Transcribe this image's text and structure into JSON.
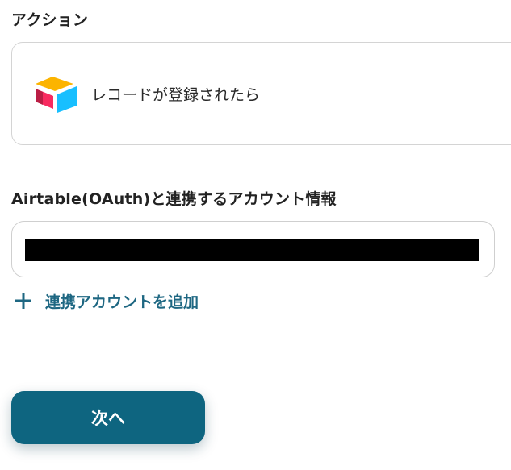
{
  "action_section": {
    "label": "アクション",
    "app_icon": "airtable-logo-icon",
    "action_text": "レコードが登録されたら"
  },
  "account_section": {
    "label": "Airtable(OAuth)と連携するアカウント情報",
    "selected_value": "",
    "add_account_icon": "plus-icon",
    "add_account_label": "連携アカウントを追加"
  },
  "footer": {
    "next_label": "次へ"
  },
  "colors": {
    "primary": "#0e6580",
    "link": "#1e6782",
    "border": "#d4d4d4",
    "redacted": "#000000"
  }
}
